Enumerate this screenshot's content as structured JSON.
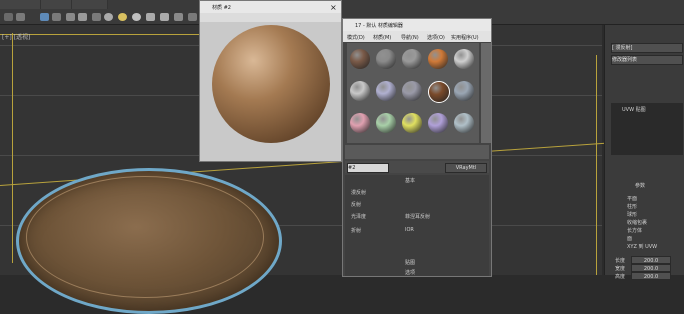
{
  "preview_window": {
    "title": "材质 #2"
  },
  "mat_editor": {
    "title": "17 - 默认 材质编辑器",
    "menu": [
      "模式(D)",
      "材质(M)",
      "导航(N)",
      "选项(O)",
      "实用程序(U)"
    ],
    "slot_colors": [
      "#7a5a48",
      "#8a8a8a",
      "#9a9a9a",
      "#d07a38",
      "#cfcfcf",
      "#c8c8c8",
      "#b0b0d0",
      "#9a9aa8",
      "#7a4a2a",
      "#9aa6b4",
      "#e0a0b0",
      "#a8d0a8",
      "#e0e060",
      "#b0a0d8",
      "#b0c0c8"
    ],
    "name_field": "#2",
    "type_btn": "VRayMtl",
    "section_basic": "基本",
    "param_labels": [
      "漫反射",
      "反射",
      "光泽度",
      "菲涅耳反射",
      "折射",
      "IOR"
    ],
    "section_maps": "贴图",
    "options": "选项"
  },
  "command_panel": {
    "object_name": "[ 漫反射]",
    "modifier_list": "修改器列表",
    "stack_item": "UVW 贴图",
    "section": "参数",
    "radio_items": [
      "平面",
      "柱形",
      "球形",
      "收缩包裹",
      "长方体",
      "面",
      "XYZ 到 UVW"
    ],
    "length_label": "长度",
    "width_label": "宽度",
    "height_label": "高度",
    "length_val": "200.0",
    "width_val": "200.0",
    "height_val": "200.0"
  },
  "viewport": {
    "label": "[+] [透视]"
  }
}
